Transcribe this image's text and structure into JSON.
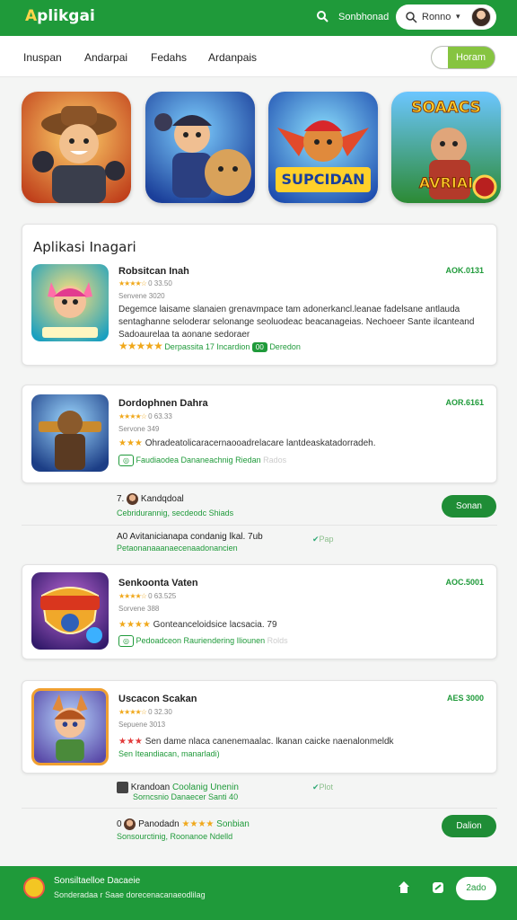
{
  "app": {
    "logo": "Aplikgai",
    "logo_lead": "A"
  },
  "topbar": {
    "link": "Sonbhonad",
    "search_value": "Ronno",
    "caret": "▾"
  },
  "nav": {
    "items": [
      "Inuspan",
      "Andarpai",
      "Fedahs",
      "Ardanpais"
    ],
    "toggle_label": "Horam"
  },
  "featured": [
    {
      "title": ""
    },
    {
      "title": ""
    },
    {
      "title": "SUPCIDAN"
    },
    {
      "title": "SOAACS",
      "subtitle": "AVRIAI"
    }
  ],
  "section": {
    "title": "Aplikasi Inagari"
  },
  "cards": [
    {
      "name": "Robsitcan Inah",
      "price": "AOK.0131",
      "stars": "★★★★☆",
      "rating_text": "0 33.50",
      "sub": "Senvene 3020",
      "desc": "Degemce laisame slanaien grenavmpace tam adonerkancl.leanae fadelsane antlauda sentaghanne seloderar selonange seoluodeac beacanageias. Nechoeer Sante ilcanteand Sadoaurelaa ta aonane sedoraer",
      "meta_stars": "★★★★★",
      "meta_text": "Derpassita 17  Incardion",
      "badge": "00",
      "meta_right": "Deredon"
    },
    {
      "name": "Dordophnen Dahra",
      "price": "AOR.6161",
      "stars": "★★★★☆",
      "rating_text": "0 63.33",
      "sub": "Servone 349",
      "desc_stars": "★★★",
      "desc": "Ohradeatolicaracernaooadrelacare lantdeaskatadorradeh.",
      "meta_text": "Faudiaodea Dananeachnig Riedan",
      "meta_fade": "Rados"
    },
    {
      "name": "Senkoonta Vaten",
      "price": "AOC.5001",
      "stars": "★★★★☆",
      "rating_text": "0 63.525",
      "sub": "Sorvene 388",
      "desc_stars": "★★★★",
      "desc": "Gonteanceloidsice lacsacia. 79",
      "meta_text": "Pedoadceon Rauriendering Iliounen",
      "meta_fade": "Rolds"
    },
    {
      "name": "Uscacon Scakan",
      "price": "AES 3000",
      "stars": "★★★★☆",
      "rating_text": "0 32.30",
      "sub": "Sepuene 3013",
      "desc_stars": "★★★",
      "desc": "Sen dame nlaca canenemaalac. lkanan caicke naenalonmeldk",
      "meta_text": "Sen Iteandiacan, manarladi)"
    }
  ],
  "rows": [
    {
      "prefix": "7.",
      "name": "Kandqdoal",
      "sub": "Cebridurannig, secdeodc Shiads"
    },
    {
      "text": "A0 Avitanicianapa condanig lkal. 7ub",
      "sub": "Petaonanaaanaecenaadonancien",
      "badge": "0",
      "badge_text": "Pap",
      "pill": "Sonan"
    },
    {
      "name": "Krandoan",
      "mid": "Coolanig Unenin",
      "sub": "Sorncsnio Danaecer Santi 40",
      "badge": "0",
      "badge_text": "Plot"
    },
    {
      "prefix": "0",
      "name": "Panodadn",
      "stars": "★★★★",
      "after": "Sonbian",
      "sub": "Sonsourctinig, Roonanoe Ndelld",
      "pill": "Dalion"
    }
  ],
  "bottombar": {
    "title": "Sonsiltaelloe   Dacaeie",
    "subtitle": "Sonderadaa r  Saae dorecenacanaeodlilag",
    "pill": "2ado"
  }
}
